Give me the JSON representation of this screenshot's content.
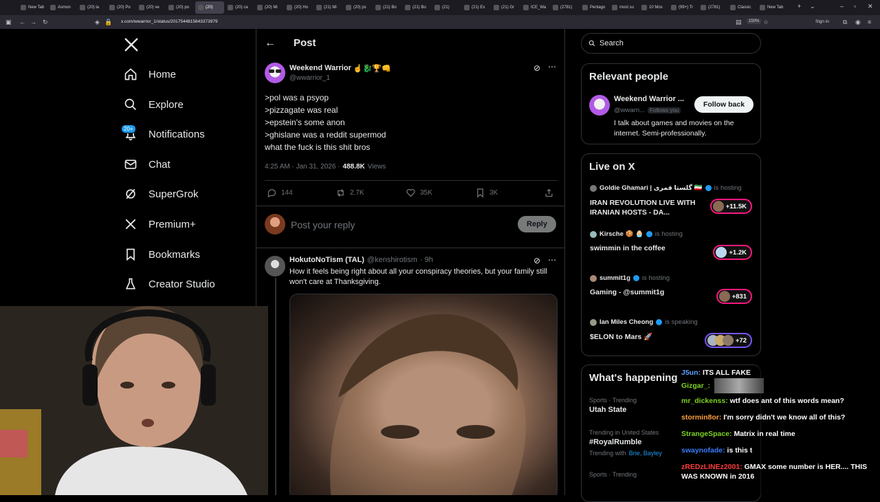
{
  "browser": {
    "tabs": [
      "New Tab",
      "Asmon",
      "(20) la",
      "(20) Po",
      "(20) ve",
      "(20) po",
      "(20)",
      "(20) ca",
      "(20) Mi",
      "(20) Ho",
      "(21) Mi",
      "(20) ps",
      "(21) Bo",
      "(21) Bo",
      "(21)",
      "(21) Ex",
      "(21) Gr",
      "ICE_Wa",
      "(2781)",
      "Pentago",
      "most su",
      "10 Mos",
      "(99+) Tr",
      "(2781)",
      "Classic",
      "New Tab"
    ],
    "active_tab_index": 6,
    "url": "x.com/wwarrior_1/status/2017544815643373979",
    "zoom": "150%",
    "sign_in": "Sign in"
  },
  "left_nav": {
    "items": [
      {
        "label": "Home",
        "icon": "home-icon"
      },
      {
        "label": "Explore",
        "icon": "search-icon"
      },
      {
        "label": "Notifications",
        "icon": "bell-icon",
        "badge": "20+"
      },
      {
        "label": "Chat",
        "icon": "mail-icon"
      },
      {
        "label": "SuperGrok",
        "icon": "grok-icon"
      },
      {
        "label": "Premium+",
        "icon": "x-logo-icon"
      },
      {
        "label": "Bookmarks",
        "icon": "bookmark-icon"
      },
      {
        "label": "Creator Studio",
        "icon": "flask-icon"
      }
    ]
  },
  "post": {
    "header_title": "Post",
    "author_name": "Weekend Warrior",
    "author_emoji": "☝️🐉🏆👊",
    "author_handle": "@wwarrior_1",
    "lines": [
      ">pol was a psyop",
      ">pizzagate was real",
      ">epstein's some anon",
      ">ghislane was a reddit supermod",
      "what the fuck is this shit bros"
    ],
    "timestamp": "4:25 AM · Jan 31, 2026 ·",
    "views_count": "488.8K",
    "views_label": "Views",
    "replies": "144",
    "reposts": "2.7K",
    "likes": "35K",
    "bookmarks": "3K",
    "reply_placeholder": "Post your reply",
    "reply_button": "Reply"
  },
  "reply_tweet": {
    "author_name": "HokutoNoTism (TAL)",
    "author_handle": "@kenshirotism",
    "time": "· 9h",
    "text": "How it feels being right about all your conspiracy theories, but your family still won't care at Thanksgiving."
  },
  "search": {
    "placeholder": "Search"
  },
  "relevant_people": {
    "title": "Relevant people",
    "name": "Weekend Warrior ...",
    "handle": "@wwarri...",
    "follows_you": "Follows you",
    "follow_button": "Follow back",
    "bio": "I talk about games and movies on the internet. Semi-professionally."
  },
  "live": {
    "title": "Live on X",
    "items": [
      {
        "host": "Goldie Ghamari | گلستا قمری 🇮🇷",
        "status": "is hosting",
        "title": "IRAN REVOLUTION LIVE WITH IRANIAN HOSTS - DA...",
        "count": "+11.5K"
      },
      {
        "host": "Kirsche 🍪 🧁",
        "status": "is hosting",
        "title": "swimmin in the coffee",
        "count": "+1.2K"
      },
      {
        "host": "summit1g",
        "status": "is hosting",
        "title": "Gaming - @summit1g",
        "count": "+831"
      },
      {
        "host": "Ian Miles Cheong",
        "status": "is speaking",
        "title": "$ELON to Mars 🚀",
        "count": "+72"
      }
    ]
  },
  "happening": {
    "title": "What's happening",
    "items": [
      {
        "context": "Sports · Trending",
        "topic": "Utah State"
      },
      {
        "context": "Trending in United States",
        "topic": "#RoyalRumble",
        "with_label": "Trending with",
        "with": "Brie, Bayley"
      },
      {
        "context": "Sports · Trending",
        "topic": ""
      }
    ]
  },
  "chat": [
    {
      "user": "J5un:",
      "msg": "ITS ALL FAKE",
      "color": "#5ea0ff"
    },
    {
      "user": "Gizgar_:",
      "msg": "",
      "color": "#7ed321"
    },
    {
      "user": "mr_dickenss:",
      "msg": "wtf does ant of this words mean?",
      "color": "#7ed321"
    },
    {
      "user": "stormin8or:",
      "msg": "I'm sorry didn't we know all of this?",
      "color": "#ff9f40"
    },
    {
      "user": "StrangeSpace:",
      "msg": "Matrix in real time",
      "color": "#7ed321"
    },
    {
      "user": "swaynofade:",
      "msg": "is this t",
      "color": "#3d7bff"
    },
    {
      "user": "zREDzLINEz2001:",
      "msg": "GMAX some number is HER.... THIS WAS KNOWN in 2016",
      "color": "#ff3b3b"
    }
  ]
}
